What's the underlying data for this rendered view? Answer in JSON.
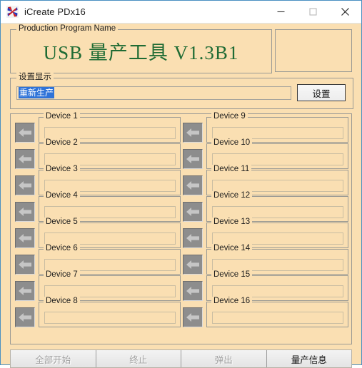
{
  "window": {
    "title": "iCreate PDx16",
    "icon": "pinwheel-app-icon",
    "controls": {
      "minimize": "–",
      "maximize": "□",
      "close": "✕"
    }
  },
  "program_group": {
    "legend": "Production Program Name",
    "title_text": "USB 量产工具 V1.3B1",
    "title_color": "#1f6b34"
  },
  "side_panel": {
    "value": ""
  },
  "settings_group": {
    "legend": "设置显示",
    "input": {
      "value": "重新生产",
      "selected": true,
      "selection_color": "#2f73d8"
    },
    "button_label": "设置"
  },
  "devices": {
    "arrow_icon": "arrow-left-icon",
    "left_column": [
      {
        "label": "Device 1",
        "value": ""
      },
      {
        "label": "Device 2",
        "value": ""
      },
      {
        "label": "Device 3",
        "value": ""
      },
      {
        "label": "Device 4",
        "value": ""
      },
      {
        "label": "Device 5",
        "value": ""
      },
      {
        "label": "Device 6",
        "value": ""
      },
      {
        "label": "Device 7",
        "value": ""
      },
      {
        "label": "Device 8",
        "value": ""
      }
    ],
    "right_column": [
      {
        "label": "Device 9",
        "value": ""
      },
      {
        "label": "Device 10",
        "value": ""
      },
      {
        "label": "Device 11",
        "value": ""
      },
      {
        "label": "Device 12",
        "value": ""
      },
      {
        "label": "Device 13",
        "value": ""
      },
      {
        "label": "Device 14",
        "value": ""
      },
      {
        "label": "Device 15",
        "value": ""
      },
      {
        "label": "Device 16",
        "value": ""
      }
    ]
  },
  "bottom_bar": {
    "buttons": [
      {
        "label": "全部开始",
        "enabled": false
      },
      {
        "label": "终止",
        "enabled": false
      },
      {
        "label": "弹出",
        "enabled": false
      },
      {
        "label": "量产信息",
        "enabled": true
      }
    ]
  },
  "colors": {
    "window_background": "#fadfb2",
    "titlebar_background": "#ffffff",
    "window_border": "#4a90c2",
    "group_border": "#9a9a94",
    "arrow_button": "#8d8d8d"
  }
}
